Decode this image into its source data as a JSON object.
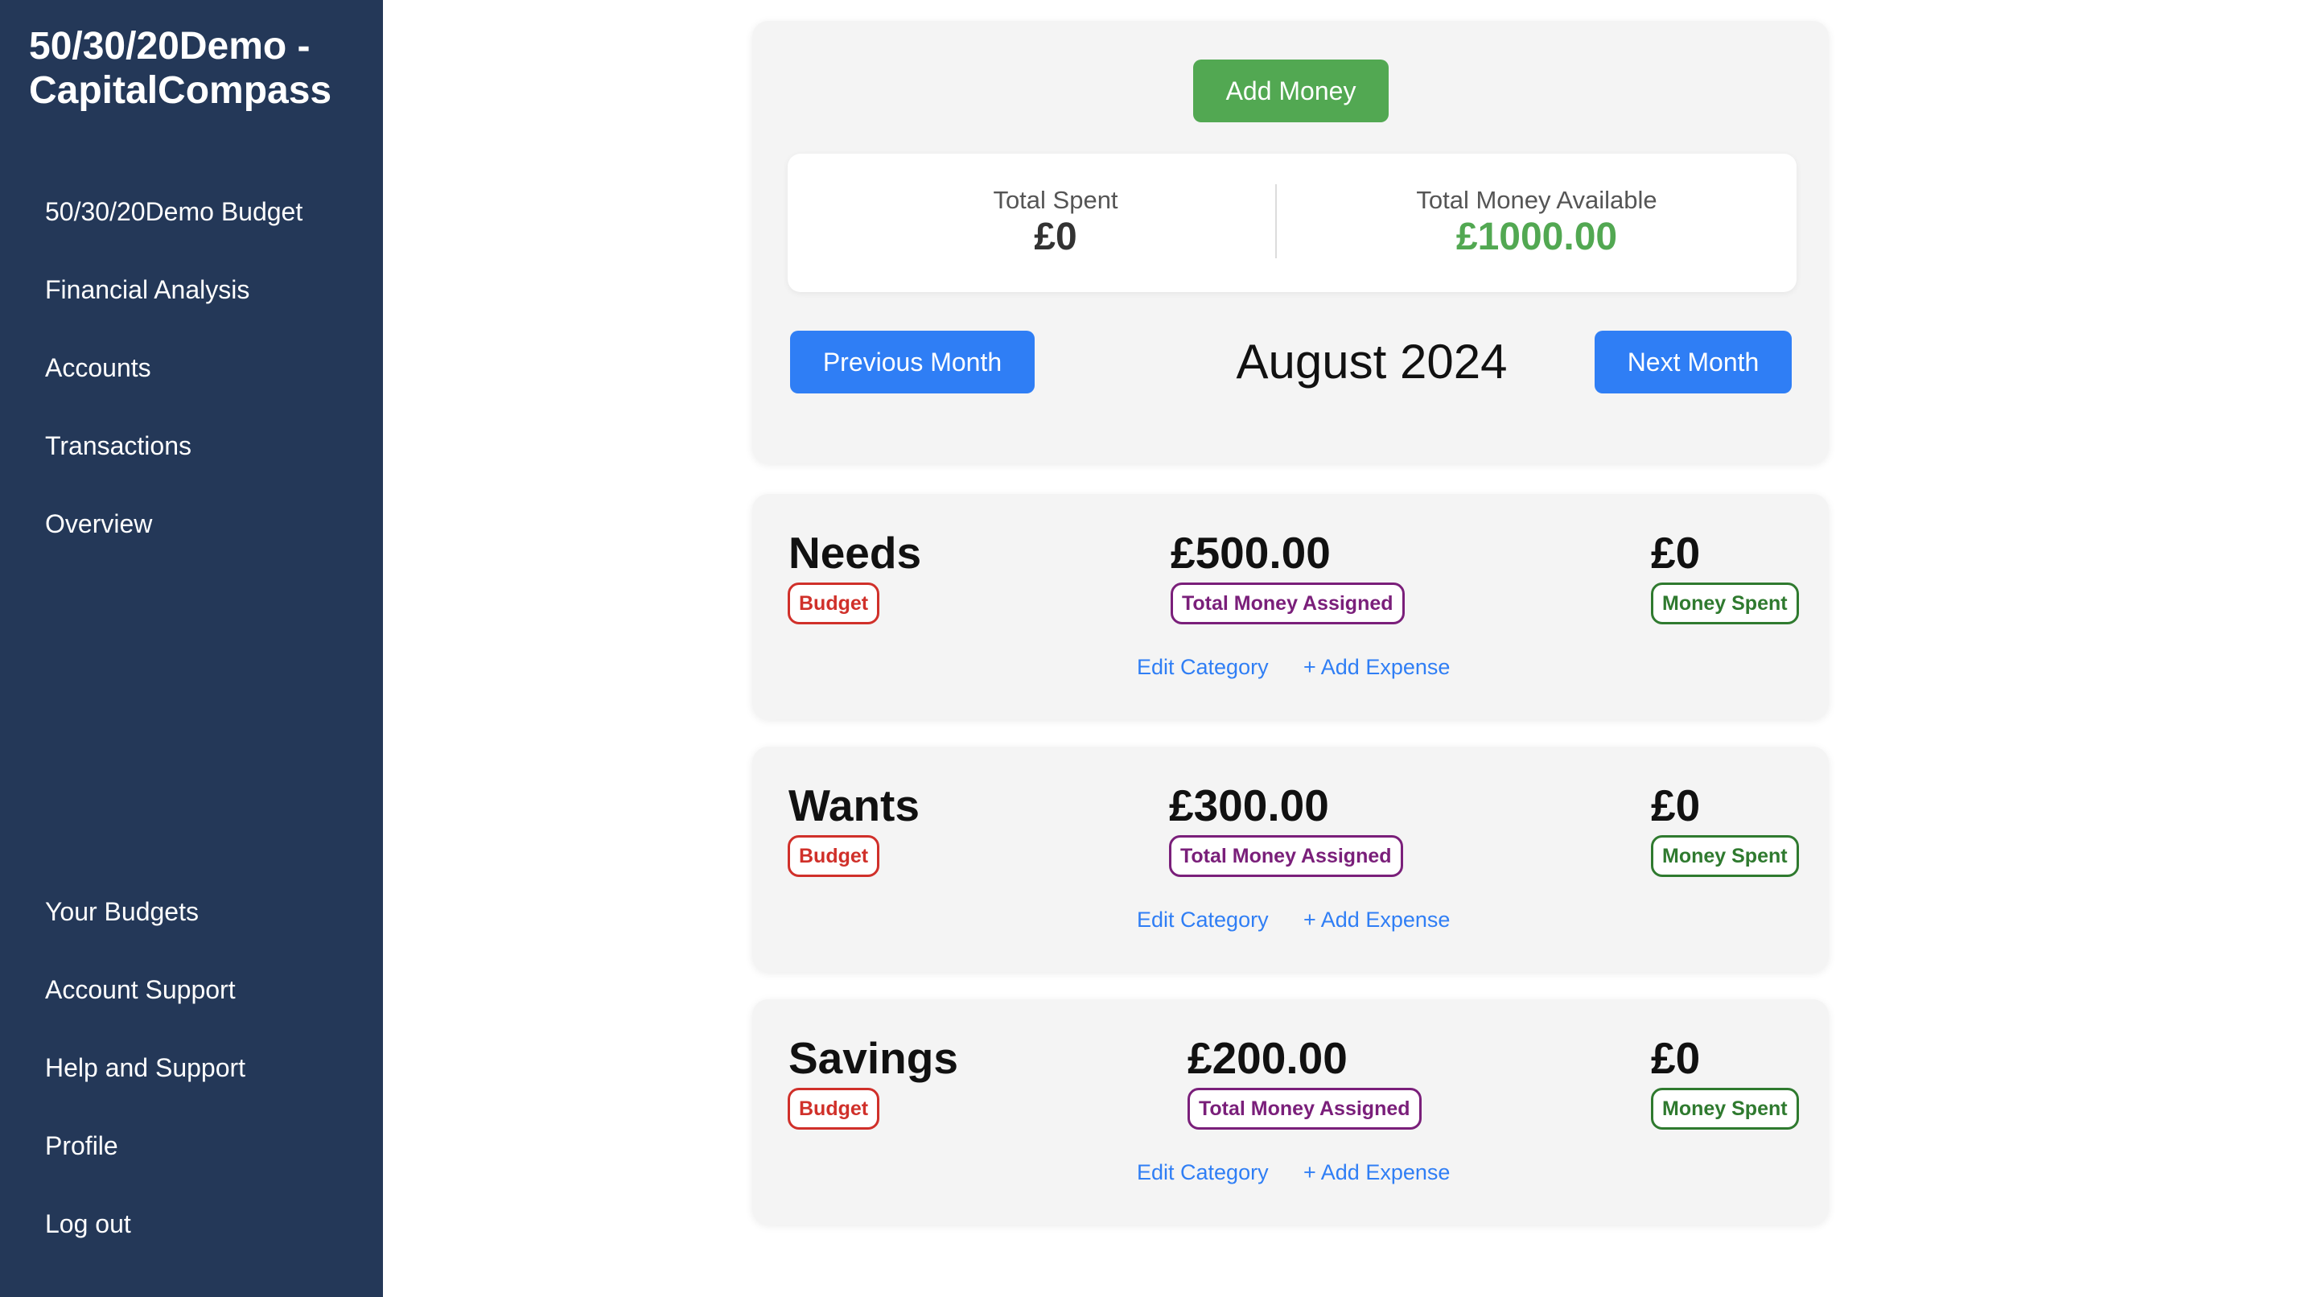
{
  "app": {
    "title": "50/30/20Demo - CapitalCompass"
  },
  "sidebar": {
    "top_items": [
      {
        "label": "50/30/20Demo Budget"
      },
      {
        "label": "Financial Analysis"
      },
      {
        "label": "Accounts"
      },
      {
        "label": "Transactions"
      },
      {
        "label": "Overview"
      }
    ],
    "bottom_items": [
      {
        "label": "Your Budgets"
      },
      {
        "label": "Account Support"
      },
      {
        "label": "Help and Support"
      },
      {
        "label": "Profile"
      },
      {
        "label": "Log out"
      }
    ]
  },
  "top": {
    "add_money_label": "Add Money",
    "total_spent_label": "Total Spent",
    "total_spent_value": "£0",
    "total_available_label": "Total Money Available",
    "total_available_value": "£1000.00",
    "prev_month_label": "Previous Month",
    "month": "August 2024",
    "next_month_label": "Next Month"
  },
  "categories": [
    {
      "name": "Needs",
      "budget_badge": "Budget",
      "assigned": "£500.00",
      "assigned_badge": "Total Money Assigned",
      "spent": "£0",
      "spent_badge": "Money Spent",
      "edit_label": "Edit Category",
      "add_expense_label": "+ Add Expense"
    },
    {
      "name": "Wants",
      "budget_badge": "Budget",
      "assigned": "£300.00",
      "assigned_badge": "Total Money Assigned",
      "spent": "£0",
      "spent_badge": "Money Spent",
      "edit_label": "Edit Category",
      "add_expense_label": "+ Add Expense"
    },
    {
      "name": "Savings",
      "budget_badge": "Budget",
      "assigned": "£200.00",
      "assigned_badge": "Total Money Assigned",
      "spent": "£0",
      "spent_badge": "Money Spent",
      "edit_label": "Edit Category",
      "add_expense_label": "+ Add Expense"
    }
  ],
  "colors": {
    "sidebar_bg": "#243858",
    "accent_green": "#52a852",
    "accent_blue": "#2f7ef5",
    "badge_red": "#d0302a",
    "badge_purple": "#7a1f7a",
    "badge_green": "#2f7a2f"
  }
}
